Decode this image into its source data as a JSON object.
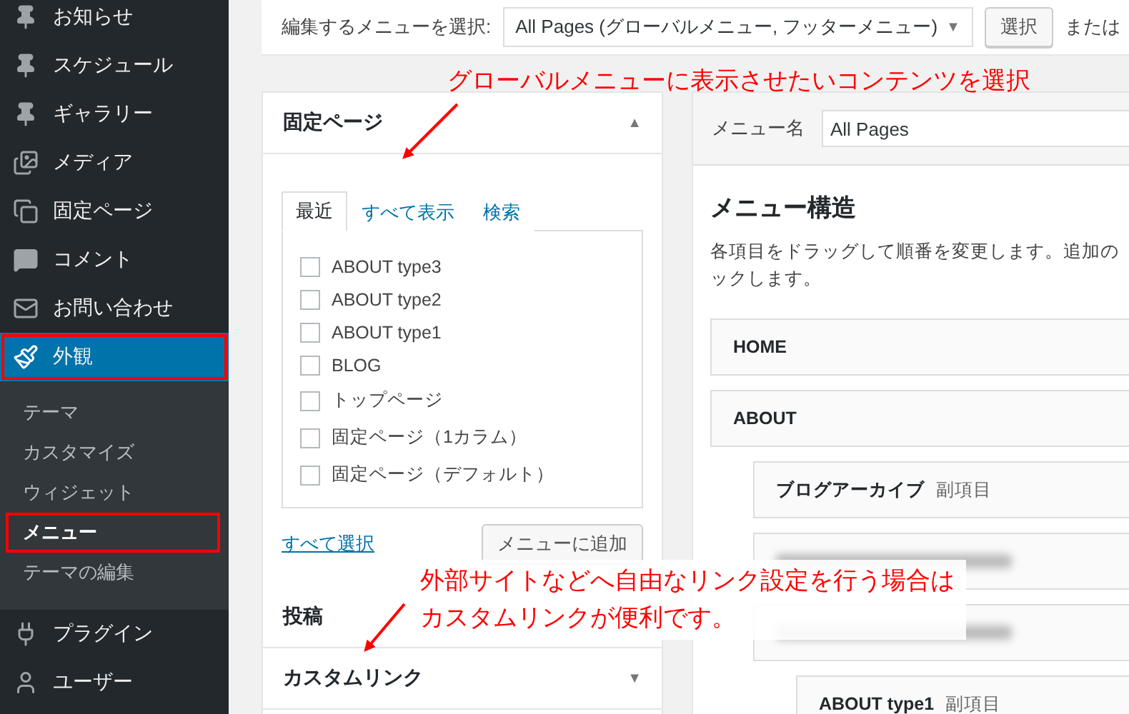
{
  "sidebar": {
    "items": [
      {
        "label": "お知らせ",
        "selected": false,
        "highlighted": false
      },
      {
        "label": "スケジュール",
        "selected": false,
        "highlighted": false
      },
      {
        "label": "ギャラリー",
        "selected": false,
        "highlighted": false
      },
      {
        "label": "メディア",
        "selected": false,
        "highlighted": false
      },
      {
        "label": "固定ページ",
        "selected": false,
        "highlighted": false
      },
      {
        "label": "コメント",
        "selected": false,
        "highlighted": false
      },
      {
        "label": "お問い合わせ",
        "selected": false,
        "highlighted": false
      },
      {
        "label": "外観",
        "selected": true,
        "highlighted": true,
        "children": [
          {
            "label": "テーマ",
            "selected": false,
            "highlighted": false
          },
          {
            "label": "カスタマイズ",
            "selected": false,
            "highlighted": false
          },
          {
            "label": "ウィジェット",
            "selected": false,
            "highlighted": false
          },
          {
            "label": "メニュー",
            "selected": true,
            "highlighted": true
          },
          {
            "label": "テーマの編集",
            "selected": false,
            "highlighted": false
          }
        ]
      },
      {
        "label": "プラグイン",
        "selected": false,
        "highlighted": false
      },
      {
        "label": "ユーザー",
        "selected": false,
        "highlighted": false
      }
    ]
  },
  "top_bar": {
    "label": "編集するメニューを選択:",
    "select_value": "All Pages (グローバルメニュー, フッターメニュー)",
    "select_arrow": "▼",
    "button": "選択",
    "trailing_text": "または"
  },
  "pages_panel": {
    "title": "固定ページ",
    "toggle": "▲",
    "tabs": [
      {
        "label": "最近",
        "selected": true
      },
      {
        "label": "すべて表示",
        "selected": false
      },
      {
        "label": "検索",
        "selected": false
      }
    ],
    "items": [
      {
        "label": "ABOUT type3",
        "checked": false
      },
      {
        "label": "ABOUT type2",
        "checked": false
      },
      {
        "label": "ABOUT type1",
        "checked": false
      },
      {
        "label": "BLOG",
        "checked": false
      },
      {
        "label": "トップページ",
        "checked": false
      },
      {
        "label": "固定ページ（1カラム）",
        "checked": false
      },
      {
        "label": "固定ページ（デフォルト）",
        "checked": false
      }
    ],
    "select_all": "すべて選択",
    "add_button": "メニューに追加"
  },
  "other_panels": [
    {
      "title": "投稿"
    },
    {
      "title": "カスタムリンク",
      "toggle": "▼"
    }
  ],
  "menu_editor": {
    "name_label": "メニュー名",
    "name_value": "All Pages",
    "heading": "メニュー構造",
    "description": [
      "各項目をドラッグして順番を変更します。追加の",
      "ックします。"
    ],
    "items": [
      {
        "label": "HOME",
        "blurred": false
      },
      {
        "label": "ABOUT",
        "blurred": false,
        "children": [
          {
            "label": "ブログアーカイブ",
            "sub_label": "副項目",
            "blurred": false
          },
          {
            "blurred": true
          },
          {
            "blurred": true,
            "children": [
              {
                "label": "ABOUT type1",
                "sub_label": "副項目",
                "blurred": false
              }
            ]
          }
        ]
      }
    ]
  },
  "annotations": [
    {
      "lines": [
        "グローバルメニューに表示させたいコンテンツを選択"
      ]
    },
    {
      "lines": [
        "外部サイトなどへ自由なリンク設定を行う場合は",
        "カスタムリンクが便利です。"
      ],
      "backdrop": true
    }
  ]
}
